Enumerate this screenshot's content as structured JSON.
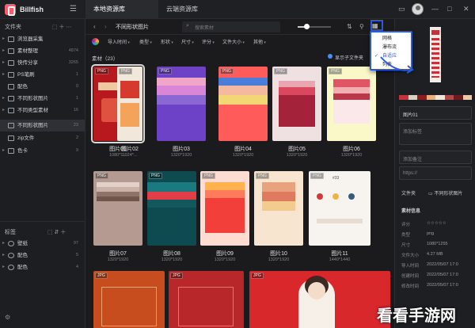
{
  "app": {
    "name": "Billfish"
  },
  "tabs": [
    {
      "label": "本地资源库"
    },
    {
      "label": "云端资源库"
    }
  ],
  "sidebar": {
    "files_header": "文件夹",
    "items": [
      {
        "label": "浏览器采集",
        "count": ""
      },
      {
        "label": "素材整理",
        "count": "4874"
      },
      {
        "label": "快传分享",
        "count": "3265"
      },
      {
        "label": "PS笔刷",
        "count": "1"
      },
      {
        "label": "配色",
        "count": "0"
      },
      {
        "label": "不同形状图片",
        "count": "1"
      },
      {
        "label": "不同类型素材",
        "count": "16"
      },
      {
        "label": "不同形状图片",
        "count": "23"
      },
      {
        "label": "zip文件",
        "count": "2"
      },
      {
        "label": "色卡",
        "count": "9"
      }
    ],
    "tags_header": "标签",
    "tags": [
      {
        "label": "壁纸",
        "count": "97"
      },
      {
        "label": "配色",
        "count": "5"
      },
      {
        "label": "配色",
        "count": "4"
      }
    ]
  },
  "toolbar": {
    "breadcrumb": "不同形状图片",
    "search_placeholder": "搜索素材"
  },
  "filters": [
    "导入时间",
    "类型",
    "形状",
    "尺寸",
    "评分",
    "文件大小",
    "其他"
  ],
  "content": {
    "count_label": "素材（23）",
    "subfolder_label": "显示子文件夹"
  },
  "assets": [
    {
      "name": "图片01",
      "size": "1080*1...",
      "type": "PNG"
    },
    {
      "name": "图片02",
      "size": "1024*...",
      "type": "PNG"
    },
    {
      "name": "图片03",
      "size": "1320*1920",
      "type": "PNG"
    },
    {
      "name": "图片04",
      "size": "1320*1920",
      "type": "PNG"
    },
    {
      "name": "图片05",
      "size": "1320*1920",
      "type": "PNG"
    },
    {
      "name": "图片06",
      "size": "1320*1920",
      "type": "PNG"
    },
    {
      "name": "图片07",
      "size": "1320*1920",
      "type": "PNG"
    },
    {
      "name": "图片08",
      "size": "1320*1920",
      "type": "PNG"
    },
    {
      "name": "图片09",
      "size": "1320*1920",
      "type": "PNG"
    },
    {
      "name": "图片10",
      "size": "1320*1920",
      "type": "PNG"
    },
    {
      "name": "图片11",
      "size": "1440*1440",
      "type": "PNG"
    },
    {
      "name": "",
      "size": "",
      "type": "JPG"
    },
    {
      "name": "",
      "size": "",
      "type": "JPG"
    },
    {
      "name": "",
      "size": "",
      "type": "JPG"
    }
  ],
  "dropdown": {
    "items": [
      {
        "label": "网格",
        "on": false
      },
      {
        "label": "瀑布流",
        "on": false
      },
      {
        "label": "自适应",
        "on": true
      },
      {
        "label": "列表",
        "on": false
      }
    ]
  },
  "right_panel": {
    "name_value": "图片01",
    "tag_placeholder": "添加标签",
    "note_placeholder": "添加备注",
    "url_placeholder": "https://",
    "folder_label": "文件夹",
    "folder_value": "不同形状图片",
    "info_title": "素材信息",
    "info": [
      {
        "k": "评分",
        "v": "☆☆☆☆☆"
      },
      {
        "k": "类型",
        "v": "png"
      },
      {
        "k": "尺寸",
        "v": "1080*1255"
      },
      {
        "k": "文件大小",
        "v": "4.27 MB"
      },
      {
        "k": "导入时间",
        "v": "2022/05/07 17:0"
      },
      {
        "k": "创建时间",
        "v": "2022/05/07 17:0"
      },
      {
        "k": "修改时间",
        "v": "2022/05/07 17:0"
      }
    ],
    "palette": [
      "#c4323b",
      "#d9d0c4",
      "#8b1c22",
      "#e8b07a",
      "#f0e6da",
      "#b04a46",
      "#6d1a1c",
      "#efc9a6"
    ]
  },
  "watermark": "看看手游网"
}
